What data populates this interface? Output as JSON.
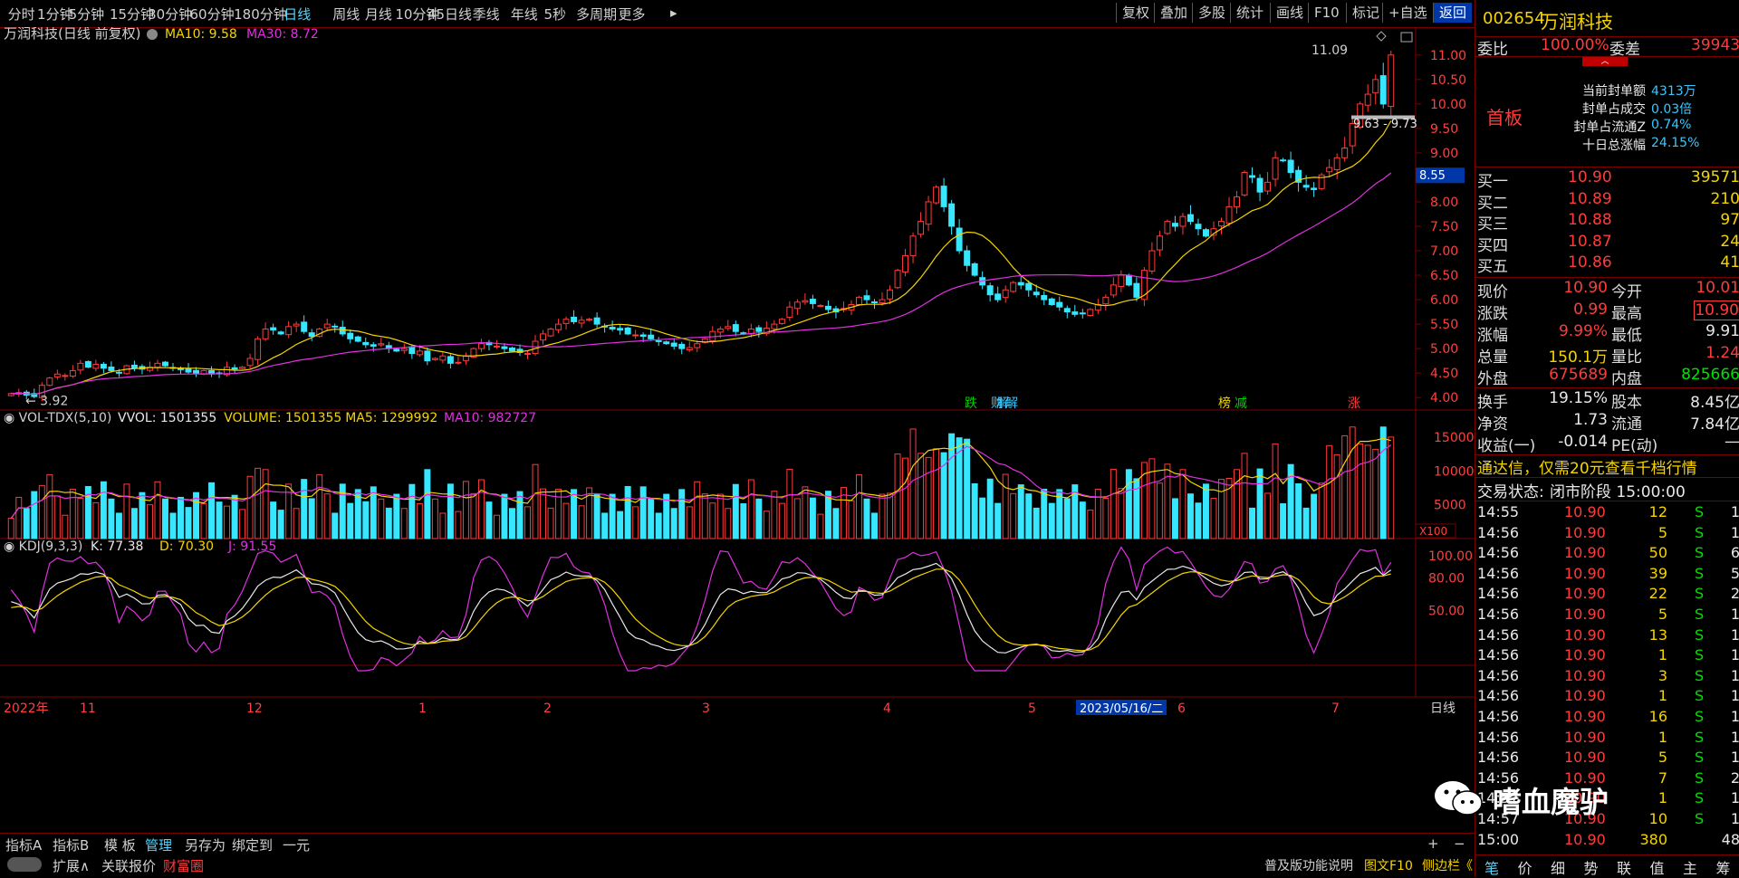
{
  "toolbar": {
    "periods": [
      "分时",
      "1分钟",
      "5分钟",
      "15分钟",
      "30分钟",
      "60分钟",
      "180分钟",
      "日线",
      "周线",
      "月线",
      "10分钟",
      "45日线",
      "季线",
      "年线",
      "5秒",
      "多周期",
      "更多"
    ],
    "active": "日线",
    "right_buttons": [
      "复权",
      "叠加",
      "多股",
      "统计",
      "画线",
      "F10",
      "标记",
      "+自选",
      "返回"
    ]
  },
  "chart": {
    "title": "万润科技(日线 前复权)",
    "ma_labels": [
      {
        "text": "MA10: 9.58",
        "color": "#f5d400"
      },
      {
        "text": "MA30: 8.72",
        "color": "#e030e0"
      }
    ],
    "price_ticks": [
      "11.00",
      "10.50",
      "10.00",
      "9.50",
      "9.00",
      "8.50",
      "8.00",
      "7.50",
      "7.00",
      "6.50",
      "6.00",
      "5.50",
      "5.00",
      "4.50",
      "4.00"
    ],
    "crosshair_price": "8.55",
    "high_annot": "11.09",
    "low_annot": "3.92",
    "range_annot": "9.63 - 9.73",
    "event_tags": [
      {
        "text": "跌",
        "color": "#00d000"
      },
      {
        "text": "解",
        "color": "#37c8ff"
      },
      {
        "text": "榜",
        "color": "#f5d400"
      },
      {
        "text": "减",
        "color": "#00d000"
      },
      {
        "text": "涨",
        "color": "#ff3b3b"
      }
    ],
    "vol_title": "VOL-TDX(5,10)",
    "vol_labels": [
      {
        "text": "VVOL: 1501355",
        "color": "#e8e8e8"
      },
      {
        "text": "VOLUME: 1501355",
        "color": "#f5d400"
      },
      {
        "text": "MA5: 1299992",
        "color": "#f5d400"
      },
      {
        "text": "MA10: 982727",
        "color": "#e030e0"
      }
    ],
    "vol_ticks": [
      "15000",
      "10000",
      "5000"
    ],
    "vol_unit": "X100",
    "kdj_title": "KDJ(9,3,3)",
    "kdj_labels": [
      {
        "text": "K: 77.38",
        "color": "#e8e8e8"
      },
      {
        "text": "D: 70.30",
        "color": "#f5d400"
      },
      {
        "text": "J: 91.55",
        "color": "#e030e0"
      }
    ],
    "kdj_ticks": [
      "100.00",
      "80.00",
      "50.00"
    ],
    "date_labels": [
      "2022年",
      "11",
      "12",
      "1",
      "2",
      "3",
      "4",
      "5",
      "6",
      "7"
    ],
    "date_cursor": "2023/05/16/二",
    "period_label": "日线"
  },
  "chart_data": {
    "type": "candlestick",
    "price_range": [
      3.8,
      11.2
    ],
    "closes": [
      4.08,
      4.1,
      4.05,
      4.02,
      4.25,
      4.4,
      4.48,
      4.45,
      4.55,
      4.7,
      4.62,
      4.68,
      4.6,
      4.55,
      4.5,
      4.65,
      4.6,
      4.58,
      4.62,
      4.7,
      4.65,
      4.6,
      4.58,
      4.52,
      4.5,
      4.55,
      4.48,
      4.5,
      4.62,
      4.58,
      4.62,
      4.8,
      5.2,
      5.4,
      5.38,
      5.3,
      5.45,
      5.5,
      5.35,
      5.25,
      5.4,
      5.5,
      5.45,
      5.3,
      5.2,
      5.15,
      5.08,
      5.05,
      5.1,
      5.0,
      4.95,
      5.0,
      4.9,
      4.95,
      4.75,
      4.8,
      4.85,
      4.7,
      4.72,
      4.85,
      5.0,
      5.1,
      5.08,
      5.05,
      5.0,
      4.95,
      4.92,
      4.9,
      5.15,
      5.3,
      5.4,
      5.5,
      5.6,
      5.55,
      5.58,
      5.6,
      5.5,
      5.45,
      5.4,
      5.38,
      5.3,
      5.28,
      5.25,
      5.2,
      5.15,
      5.1,
      5.05,
      5.0,
      5.02,
      5.1,
      5.2,
      5.35,
      5.4,
      5.45,
      5.35,
      5.3,
      5.4,
      5.35,
      5.42,
      5.5,
      5.6,
      5.85,
      5.95,
      5.98,
      5.92,
      5.88,
      5.8,
      5.75,
      5.82,
      5.9,
      6.05,
      6.0,
      5.95,
      6.0,
      6.2,
      6.6,
      6.9,
      7.3,
      7.6,
      8.0,
      8.3,
      7.9,
      7.5,
      7.0,
      6.7,
      6.5,
      6.3,
      6.1,
      6.0,
      6.2,
      6.35,
      6.3,
      6.2,
      6.1,
      6.0,
      5.9,
      5.85,
      5.75,
      5.7,
      5.72,
      5.8,
      5.9,
      6.05,
      6.3,
      6.5,
      6.3,
      6.05,
      6.6,
      7.0,
      7.3,
      7.6,
      7.5,
      7.7,
      7.6,
      7.45,
      7.3,
      7.45,
      7.6,
      7.9,
      8.1,
      8.6,
      8.5,
      8.2,
      8.4,
      8.9,
      8.85,
      8.6,
      8.4,
      8.3,
      8.25,
      8.55,
      8.7,
      8.9,
      9.1,
      9.6,
      10.0,
      10.2,
      10.5,
      10.0,
      11.0
    ],
    "volume_max": 17000,
    "kdj_range": [
      0,
      110
    ],
    "k_last": 77.38,
    "d_last": 70.3,
    "j_last": 91.55
  },
  "quote": {
    "code": "002654",
    "name": "万润科技",
    "weibi_label": "委比",
    "weibi": "100.00%",
    "weicha_label": "委差",
    "weicha": "39943",
    "board": "首板",
    "seal_stats": [
      {
        "label": "当前封单额",
        "value": "4313万"
      },
      {
        "label": "封单占成交",
        "value": "0.03倍"
      },
      {
        "label": "封单占流通Z",
        "value": "0.74%"
      },
      {
        "label": "十日总涨幅",
        "value": "24.15%"
      }
    ],
    "bids": [
      {
        "label": "买一",
        "price": "10.90",
        "vol": "39571"
      },
      {
        "label": "买二",
        "price": "10.89",
        "vol": "210"
      },
      {
        "label": "买三",
        "price": "10.88",
        "vol": "97"
      },
      {
        "label": "买四",
        "price": "10.87",
        "vol": "24"
      },
      {
        "label": "买五",
        "price": "10.86",
        "vol": "41"
      }
    ],
    "stats": [
      {
        "l1": "现价",
        "v1": "10.90",
        "c1": "red",
        "l2": "今开",
        "v2": "10.01",
        "c2": "red"
      },
      {
        "l1": "涨跌",
        "v1": "0.99",
        "c1": "red",
        "l2": "最高",
        "v2": "10.90",
        "c2": "red"
      },
      {
        "l1": "涨幅",
        "v1": "9.99%",
        "c1": "red",
        "l2": "最低",
        "v2": "9.91",
        "c2": "white"
      },
      {
        "l1": "总量",
        "v1": "150.1万",
        "c1": "yellow",
        "l2": "量比",
        "v2": "1.24",
        "c2": "red"
      },
      {
        "l1": "外盘",
        "v1": "675689",
        "c1": "red",
        "l2": "内盘",
        "v2": "825666",
        "c2": "green"
      }
    ],
    "stats2": [
      {
        "l1": "换手",
        "v1": "19.15%",
        "l2": "股本",
        "v2": "8.45亿"
      },
      {
        "l1": "净资",
        "v1": "1.73",
        "l2": "流通",
        "v2": "7.84亿"
      },
      {
        "l1": "收益(一)",
        "v1": "-0.014",
        "l2": "PE(动)",
        "v2": "—"
      }
    ],
    "promo": "通达信，仅需20元查看千档行情",
    "trade_status_label": "交易状态:",
    "trade_status": "闭市阶段 15:00:00",
    "ticks": [
      {
        "t": "14:55",
        "p": "10.90",
        "v": "12",
        "s": "S",
        "n": "1"
      },
      {
        "t": "14:56",
        "p": "10.90",
        "v": "5",
        "s": "S",
        "n": "1"
      },
      {
        "t": "14:56",
        "p": "10.90",
        "v": "50",
        "s": "S",
        "n": "6"
      },
      {
        "t": "14:56",
        "p": "10.90",
        "v": "39",
        "s": "S",
        "n": "5"
      },
      {
        "t": "14:56",
        "p": "10.90",
        "v": "22",
        "s": "S",
        "n": "2"
      },
      {
        "t": "14:56",
        "p": "10.90",
        "v": "5",
        "s": "S",
        "n": "1"
      },
      {
        "t": "14:56",
        "p": "10.90",
        "v": "13",
        "s": "S",
        "n": "1"
      },
      {
        "t": "14:56",
        "p": "10.90",
        "v": "1",
        "s": "S",
        "n": "1"
      },
      {
        "t": "14:56",
        "p": "10.90",
        "v": "3",
        "s": "S",
        "n": "1"
      },
      {
        "t": "14:56",
        "p": "10.90",
        "v": "1",
        "s": "S",
        "n": "1"
      },
      {
        "t": "14:56",
        "p": "10.90",
        "v": "16",
        "s": "S",
        "n": "1"
      },
      {
        "t": "14:56",
        "p": "10.90",
        "v": "1",
        "s": "S",
        "n": "1"
      },
      {
        "t": "14:56",
        "p": "10.90",
        "v": "5",
        "s": "S",
        "n": "1"
      },
      {
        "t": "14:56",
        "p": "10.90",
        "v": "7",
        "s": "S",
        "n": "2"
      },
      {
        "t": "14:57",
        "p": "10.90",
        "v": "1",
        "s": "S",
        "n": "1"
      },
      {
        "t": "14:57",
        "p": "10.90",
        "v": "10",
        "s": "S",
        "n": "1"
      },
      {
        "t": "15:00",
        "p": "10.90",
        "v": "380",
        "s": "",
        "n": "48"
      }
    ],
    "bottom_tabs": [
      "笔",
      "价",
      "细",
      "势",
      "联",
      "值",
      "主",
      "筹"
    ]
  },
  "bottom": {
    "tabs": [
      "指标A",
      "指标B",
      "模 板",
      "管理",
      "另存为",
      "绑定到",
      "一元"
    ],
    "tabs2": [
      "扩展∧",
      "关联报价",
      "财富圈"
    ],
    "right": [
      "普及版功能说明",
      "图文F10",
      "侧边栏《"
    ]
  },
  "watermark": "嗜血魔驴"
}
